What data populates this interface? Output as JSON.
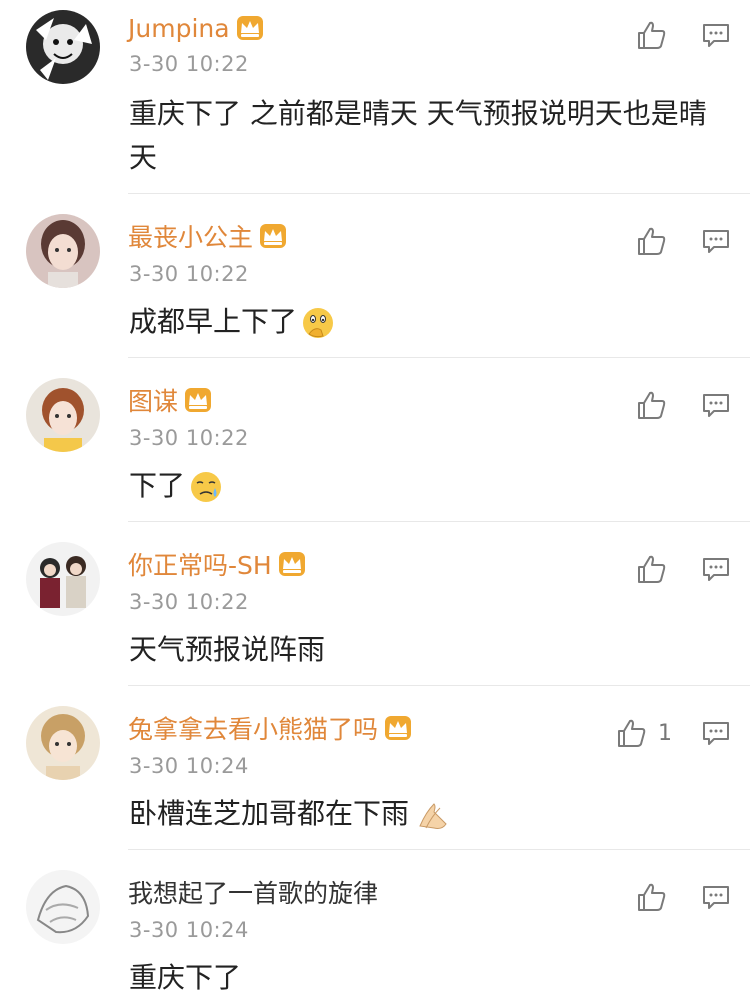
{
  "comments": [
    {
      "name": "Jumpina",
      "time": "3-30 10:22",
      "text": "重庆下了 之前都是晴天 天气预报说明天也是晴天",
      "likes": "",
      "emoji": ""
    },
    {
      "name": "最丧小公主",
      "time": "3-30 10:22",
      "text": "成都早上下了",
      "likes": "",
      "emoji": "thinking-face"
    },
    {
      "name": "图谋",
      "time": "3-30 10:22",
      "text": "下了",
      "likes": "",
      "emoji": "sad-sweat-face"
    },
    {
      "name": "你正常吗-SH",
      "time": "3-30 10:22",
      "text": "天气预报说阵雨",
      "likes": "",
      "emoji": ""
    },
    {
      "name": "兔拿拿去看小熊猫了吗",
      "time": "3-30 10:24",
      "text": "卧槽连芝加哥都在下雨",
      "likes": "1",
      "emoji": "praying-hands"
    },
    {
      "name": "我想起了一首歌的旋律",
      "time": "3-30 10:24",
      "text": "重庆下了",
      "likes": "",
      "emoji": ""
    }
  ],
  "icons": {
    "like": "thumbs-up-icon",
    "reply": "comment-icon",
    "vip": "crown-badge-icon"
  },
  "colors": {
    "username": "#e0873a",
    "timestamp": "#9a9a9a",
    "body_text": "#222222",
    "badge": "#f0a830"
  }
}
